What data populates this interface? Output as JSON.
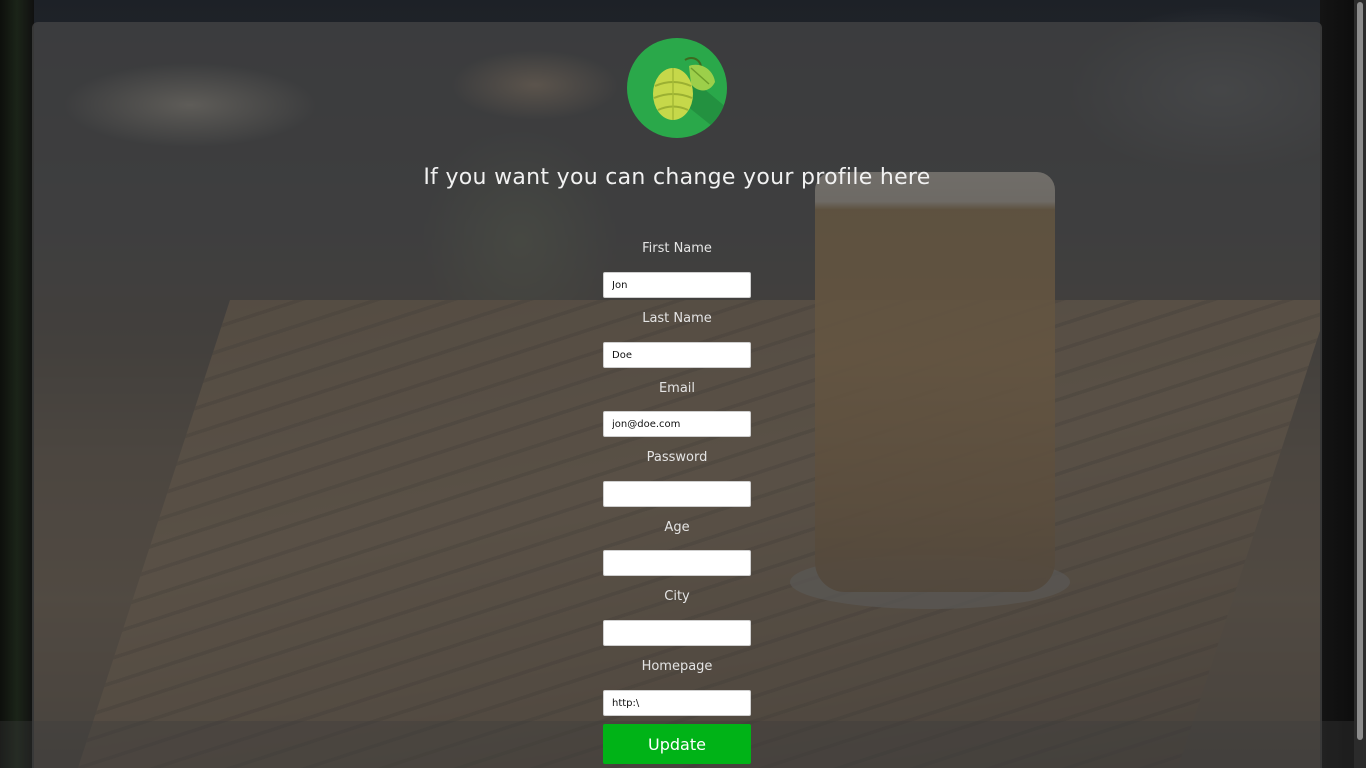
{
  "page": {
    "title": "If you want you can change your profile here",
    "logo": "hop-logo"
  },
  "form": {
    "fields": [
      {
        "label": "First Name",
        "value": "Jon",
        "placeholder": ""
      },
      {
        "label": "Last Name",
        "value": "Doe",
        "placeholder": ""
      },
      {
        "label": "Email",
        "value": "jon@doe.com",
        "placeholder": ""
      },
      {
        "label": "Password",
        "value": "",
        "placeholder": ""
      },
      {
        "label": "Age",
        "value": "",
        "placeholder": ""
      },
      {
        "label": "City",
        "value": "",
        "placeholder": ""
      },
      {
        "label": "Homepage",
        "value": "http:\\",
        "placeholder": ""
      }
    ],
    "submit_label": "Update"
  },
  "colors": {
    "button": "#00b317",
    "logo_circle": "#2aa84a"
  }
}
